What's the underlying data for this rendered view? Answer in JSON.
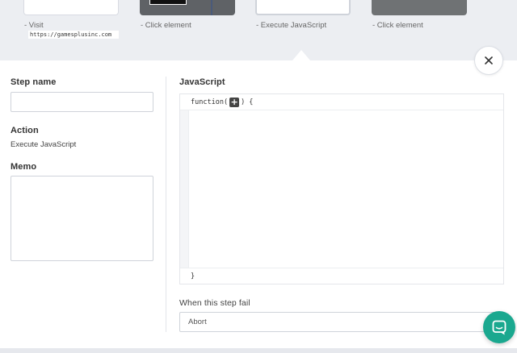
{
  "steps": [
    {
      "label": "- Visit",
      "url": "https://gamesplusinc.com",
      "thumb": "white"
    },
    {
      "label": "- Click element",
      "thumb": "screenshot"
    },
    {
      "label": "- Execute JavaScript",
      "thumb": "selected"
    },
    {
      "label": "- Click element",
      "thumb": "dark"
    }
  ],
  "form": {
    "step_name_label": "Step name",
    "step_name_value": "",
    "action_label": "Action",
    "action_value": "Execute JavaScript",
    "memo_label": "Memo",
    "memo_value": "",
    "javascript_label": "JavaScript",
    "code_head_open": "function(",
    "code_head_close": ") {",
    "plus_symbol": "+",
    "code_body": "",
    "code_foot": "}",
    "fail_label": "When this step fail",
    "fail_value": "Abort"
  },
  "icons": {
    "close": "close-icon",
    "chat": "chat-icon",
    "plus": "plus-icon"
  },
  "colors": {
    "accent": "#1aa88f",
    "background": "#f1f2f5"
  }
}
